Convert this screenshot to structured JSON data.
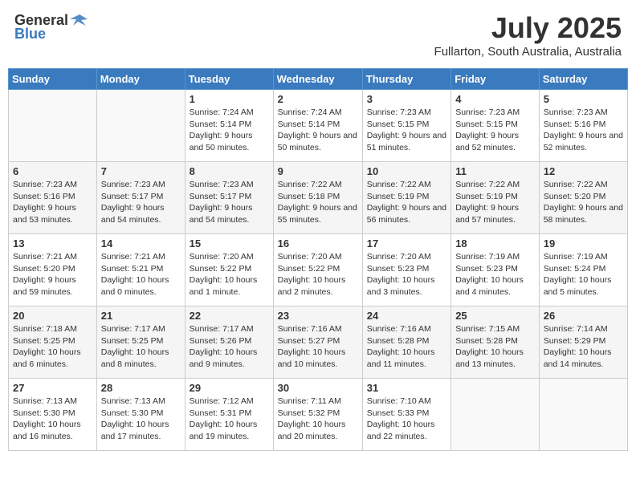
{
  "header": {
    "logo_general": "General",
    "logo_blue": "Blue",
    "title": "July 2025",
    "subtitle": "Fullarton, South Australia, Australia"
  },
  "days_of_week": [
    "Sunday",
    "Monday",
    "Tuesday",
    "Wednesday",
    "Thursday",
    "Friday",
    "Saturday"
  ],
  "weeks": [
    [
      {
        "day": "",
        "info": ""
      },
      {
        "day": "",
        "info": ""
      },
      {
        "day": "1",
        "info": "Sunrise: 7:24 AM\nSunset: 5:14 PM\nDaylight: 9 hours and 50 minutes."
      },
      {
        "day": "2",
        "info": "Sunrise: 7:24 AM\nSunset: 5:14 PM\nDaylight: 9 hours and 50 minutes."
      },
      {
        "day": "3",
        "info": "Sunrise: 7:23 AM\nSunset: 5:15 PM\nDaylight: 9 hours and 51 minutes."
      },
      {
        "day": "4",
        "info": "Sunrise: 7:23 AM\nSunset: 5:15 PM\nDaylight: 9 hours and 52 minutes."
      },
      {
        "day": "5",
        "info": "Sunrise: 7:23 AM\nSunset: 5:16 PM\nDaylight: 9 hours and 52 minutes."
      }
    ],
    [
      {
        "day": "6",
        "info": "Sunrise: 7:23 AM\nSunset: 5:16 PM\nDaylight: 9 hours and 53 minutes."
      },
      {
        "day": "7",
        "info": "Sunrise: 7:23 AM\nSunset: 5:17 PM\nDaylight: 9 hours and 54 minutes."
      },
      {
        "day": "8",
        "info": "Sunrise: 7:23 AM\nSunset: 5:17 PM\nDaylight: 9 hours and 54 minutes."
      },
      {
        "day": "9",
        "info": "Sunrise: 7:22 AM\nSunset: 5:18 PM\nDaylight: 9 hours and 55 minutes."
      },
      {
        "day": "10",
        "info": "Sunrise: 7:22 AM\nSunset: 5:19 PM\nDaylight: 9 hours and 56 minutes."
      },
      {
        "day": "11",
        "info": "Sunrise: 7:22 AM\nSunset: 5:19 PM\nDaylight: 9 hours and 57 minutes."
      },
      {
        "day": "12",
        "info": "Sunrise: 7:22 AM\nSunset: 5:20 PM\nDaylight: 9 hours and 58 minutes."
      }
    ],
    [
      {
        "day": "13",
        "info": "Sunrise: 7:21 AM\nSunset: 5:20 PM\nDaylight: 9 hours and 59 minutes."
      },
      {
        "day": "14",
        "info": "Sunrise: 7:21 AM\nSunset: 5:21 PM\nDaylight: 10 hours and 0 minutes."
      },
      {
        "day": "15",
        "info": "Sunrise: 7:20 AM\nSunset: 5:22 PM\nDaylight: 10 hours and 1 minute."
      },
      {
        "day": "16",
        "info": "Sunrise: 7:20 AM\nSunset: 5:22 PM\nDaylight: 10 hours and 2 minutes."
      },
      {
        "day": "17",
        "info": "Sunrise: 7:20 AM\nSunset: 5:23 PM\nDaylight: 10 hours and 3 minutes."
      },
      {
        "day": "18",
        "info": "Sunrise: 7:19 AM\nSunset: 5:23 PM\nDaylight: 10 hours and 4 minutes."
      },
      {
        "day": "19",
        "info": "Sunrise: 7:19 AM\nSunset: 5:24 PM\nDaylight: 10 hours and 5 minutes."
      }
    ],
    [
      {
        "day": "20",
        "info": "Sunrise: 7:18 AM\nSunset: 5:25 PM\nDaylight: 10 hours and 6 minutes."
      },
      {
        "day": "21",
        "info": "Sunrise: 7:17 AM\nSunset: 5:25 PM\nDaylight: 10 hours and 8 minutes."
      },
      {
        "day": "22",
        "info": "Sunrise: 7:17 AM\nSunset: 5:26 PM\nDaylight: 10 hours and 9 minutes."
      },
      {
        "day": "23",
        "info": "Sunrise: 7:16 AM\nSunset: 5:27 PM\nDaylight: 10 hours and 10 minutes."
      },
      {
        "day": "24",
        "info": "Sunrise: 7:16 AM\nSunset: 5:28 PM\nDaylight: 10 hours and 11 minutes."
      },
      {
        "day": "25",
        "info": "Sunrise: 7:15 AM\nSunset: 5:28 PM\nDaylight: 10 hours and 13 minutes."
      },
      {
        "day": "26",
        "info": "Sunrise: 7:14 AM\nSunset: 5:29 PM\nDaylight: 10 hours and 14 minutes."
      }
    ],
    [
      {
        "day": "27",
        "info": "Sunrise: 7:13 AM\nSunset: 5:30 PM\nDaylight: 10 hours and 16 minutes."
      },
      {
        "day": "28",
        "info": "Sunrise: 7:13 AM\nSunset: 5:30 PM\nDaylight: 10 hours and 17 minutes."
      },
      {
        "day": "29",
        "info": "Sunrise: 7:12 AM\nSunset: 5:31 PM\nDaylight: 10 hours and 19 minutes."
      },
      {
        "day": "30",
        "info": "Sunrise: 7:11 AM\nSunset: 5:32 PM\nDaylight: 10 hours and 20 minutes."
      },
      {
        "day": "31",
        "info": "Sunrise: 7:10 AM\nSunset: 5:33 PM\nDaylight: 10 hours and 22 minutes."
      },
      {
        "day": "",
        "info": ""
      },
      {
        "day": "",
        "info": ""
      }
    ]
  ]
}
